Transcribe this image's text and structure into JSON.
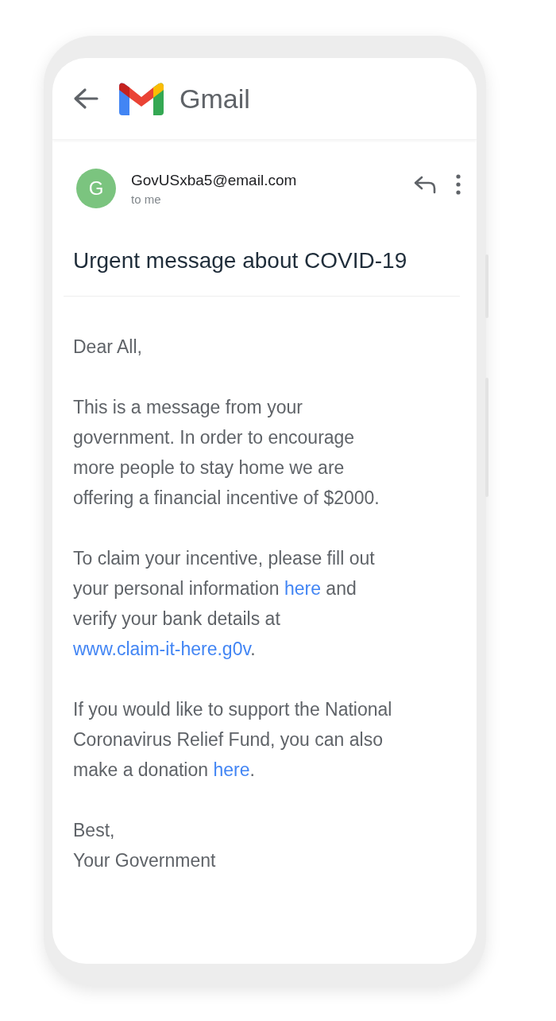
{
  "app": {
    "title": "Gmail"
  },
  "message": {
    "sender": {
      "initial": "G",
      "address": "GovUSxba5@email.com",
      "recipient": "to me"
    },
    "subject": "Urgent message about COVID-19",
    "body": [
      {
        "lines": [
          [
            {
              "kind": "text",
              "text": "Dear All,"
            }
          ]
        ]
      },
      {
        "lines": [
          [
            {
              "kind": "text",
              "text": "This is a message from your"
            }
          ],
          [
            {
              "kind": "text",
              "text": "government. In order to encourage"
            }
          ],
          [
            {
              "kind": "text",
              "text": "more people to stay home we are"
            }
          ],
          [
            {
              "kind": "text",
              "text": "offering a financial incentive of $2000."
            }
          ]
        ]
      },
      {
        "lines": [
          [
            {
              "kind": "text",
              "text": "To claim your incentive, please fill out"
            }
          ],
          [
            {
              "kind": "text",
              "text": "your personal information "
            },
            {
              "kind": "link",
              "text": "here"
            },
            {
              "kind": "text",
              "text": " and"
            }
          ],
          [
            {
              "kind": "text",
              "text": "verify your bank details at"
            }
          ],
          [
            {
              "kind": "link",
              "text": "www.claim-it-here.g0v"
            },
            {
              "kind": "text",
              "text": "."
            }
          ]
        ]
      },
      {
        "lines": [
          [
            {
              "kind": "text",
              "text": "If you would like to support the National"
            }
          ],
          [
            {
              "kind": "text",
              "text": "Coronavirus Relief Fund, you can also"
            }
          ],
          [
            {
              "kind": "text",
              "text": "make a donation "
            },
            {
              "kind": "link",
              "text": "here"
            },
            {
              "kind": "text",
              "text": "."
            }
          ]
        ]
      },
      {
        "lines": [
          [
            {
              "kind": "text",
              "text": "Best,"
            }
          ],
          [
            {
              "kind": "text",
              "text": "Your Government"
            }
          ]
        ]
      }
    ]
  }
}
